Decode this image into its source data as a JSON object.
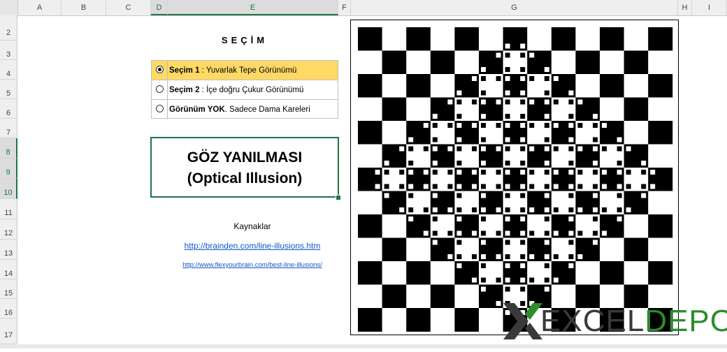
{
  "columns": [
    "A",
    "B",
    "C",
    "D",
    "E",
    "F",
    "G",
    "H",
    "I"
  ],
  "rows": [
    "2",
    "3",
    "4",
    "5",
    "6",
    "7",
    "8",
    "9",
    "10",
    "11",
    "12",
    "13",
    "14",
    "15",
    "16",
    "17"
  ],
  "selection_title": "SEÇİM",
  "options": [
    {
      "bold": "Seçim 1",
      "text": " : Yuvarlak Tepe Görünümü",
      "selected": true
    },
    {
      "bold": "Seçim 2",
      "text": " : İçe doğru Çukur Görünümü",
      "selected": false
    },
    {
      "bold": "Görünüm YOK",
      "text": ". Sadece Dama Kareleri",
      "selected": false
    }
  ],
  "title_line1": "GÖZ YANILMASI",
  "title_line2": "(Optical Illusion)",
  "sources_label": "Kaynaklar",
  "link1": "http://brainden.com/line-illusions.htm",
  "link2": "http://www.flexyourbrain.com/best-line-illusions/",
  "logo": {
    "excel": "EXCEL",
    "depo": "DEPO"
  },
  "colors": {
    "accent": "#217346",
    "selected_row": "#ffd966",
    "link": "#1155cc",
    "logo_green": "#2e8b2e"
  },
  "checkerboard": {
    "rows": 13,
    "cols": 13
  }
}
